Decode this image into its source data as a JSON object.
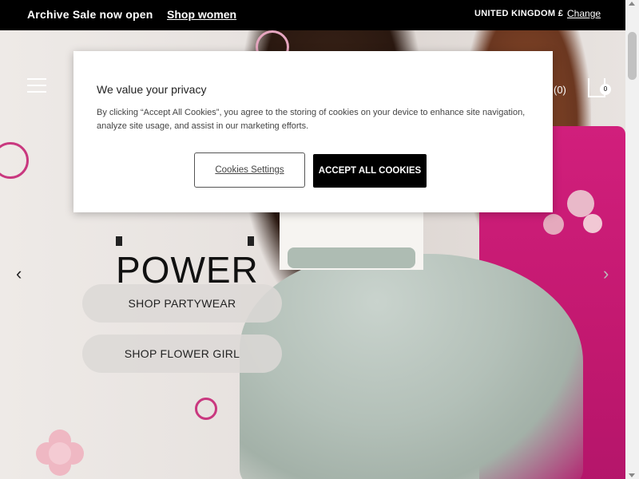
{
  "announcement": {
    "promo_text": "Archive Sale now open",
    "shop_link": "Shop women",
    "region": "UNITED KINGDOM £",
    "change_link": "Change"
  },
  "header": {
    "wishlist_count": "(0)",
    "bag_count": "0"
  },
  "hero": {
    "headline": "POWER",
    "buttons": [
      {
        "label": "SHOP PARTYWEAR"
      },
      {
        "label": "SHOP FLOWER GIRL"
      }
    ],
    "prev_icon": "chevron-left-icon",
    "next_icon": "chevron-right-icon"
  },
  "cookie_modal": {
    "title": "We value your privacy",
    "body": "By clicking “Accept All Cookies”, you agree to the storing of cookies on your device to enhance site navigation, analyze site usage, and assist in our marketing efforts.",
    "settings_label": "Cookies Settings",
    "accept_label": "ACCEPT ALL COOKIES"
  },
  "colors": {
    "topbar_bg": "#000000",
    "accent_pink": "#c2186f",
    "skirt_green": "#b3c0b8"
  }
}
